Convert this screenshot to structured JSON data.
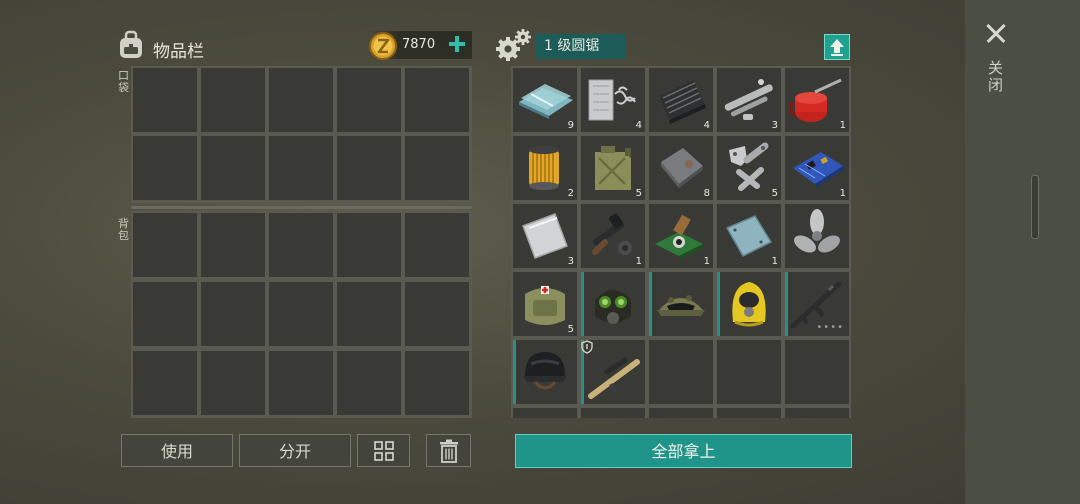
{
  "inventory": {
    "title": "物品栏",
    "coins": "7870",
    "pocket_label": "口袋",
    "backpack_label": "背包"
  },
  "buttons": {
    "use": "使用",
    "split": "分开",
    "take_all": "全部拿上"
  },
  "station": {
    "name": "1 级圆锯"
  },
  "close_label": "关闭",
  "items": [
    {
      "name": "glass-sheet-icon",
      "count": "9"
    },
    {
      "name": "metal-shavings-icon",
      "count": "4"
    },
    {
      "name": "metal-mesh-icon",
      "count": "4"
    },
    {
      "name": "pipe-and-bolts-icon",
      "count": "3"
    },
    {
      "name": "oil-can-icon",
      "count": "1"
    },
    {
      "name": "oil-filter-icon",
      "count": "2"
    },
    {
      "name": "jerry-can-icon",
      "count": "5"
    },
    {
      "name": "metal-plate-icon",
      "count": "8"
    },
    {
      "name": "hinges-icon",
      "count": "5"
    },
    {
      "name": "circuit-board-icon",
      "count": "1"
    },
    {
      "name": "steel-plate-icon",
      "count": "3"
    },
    {
      "name": "scope-parts-icon",
      "count": "1"
    },
    {
      "name": "camera-module-icon",
      "count": "1"
    },
    {
      "name": "titanium-plate-icon",
      "count": "1"
    },
    {
      "name": "propeller-icon",
      "count": ""
    },
    {
      "name": "medic-backpack-icon",
      "count": "5"
    },
    {
      "name": "gas-mask-icon",
      "count": ""
    },
    {
      "name": "military-cap-icon",
      "count": ""
    },
    {
      "name": "hazmat-hood-icon",
      "count": ""
    },
    {
      "name": "assault-rifle-icon",
      "count": ""
    },
    {
      "name": "military-helmet-icon",
      "count": ""
    },
    {
      "name": "sniper-rifle-icon",
      "count": ""
    }
  ],
  "colors": {
    "accent": "#1f9488",
    "slot": "#393a35",
    "panel": "#595a50",
    "station_bg": "#1c5b58"
  }
}
